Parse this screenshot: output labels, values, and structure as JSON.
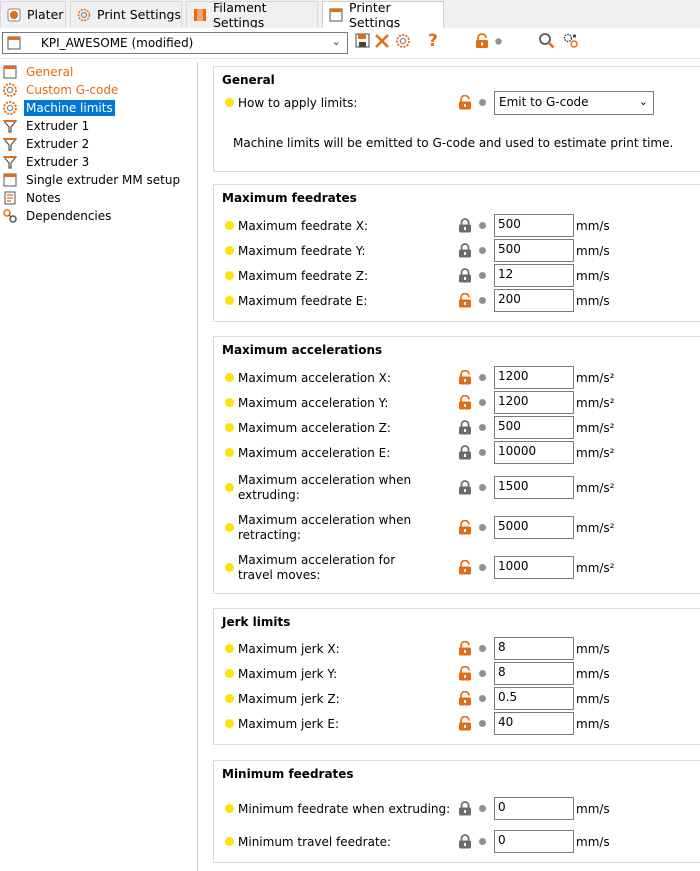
{
  "tabs": [
    {
      "label": "Plater",
      "icon": "plater-icon"
    },
    {
      "label": "Print Settings",
      "icon": "print-settings-icon"
    },
    {
      "label": "Filament Settings",
      "icon": "filament-icon"
    },
    {
      "label": "Printer Settings",
      "icon": "printer-icon",
      "active": true
    }
  ],
  "toolbar": {
    "preset_name": "KPI_AWESOME (modified)",
    "icons": [
      "save-icon",
      "delete-icon",
      "compare-icon",
      "help-icon",
      "lock-icon",
      "dot-icon",
      "search-icon",
      "filter-icon"
    ]
  },
  "sidebar": {
    "items": [
      {
        "label": "General",
        "icon": "printer-icon",
        "style": "orange"
      },
      {
        "label": "Custom G-code",
        "icon": "gear-icon",
        "style": "orange"
      },
      {
        "label": "Machine limits",
        "icon": "gear-icon",
        "style": "selected"
      },
      {
        "label": "Extruder 1",
        "icon": "extruder-icon",
        "style": ""
      },
      {
        "label": "Extruder 2",
        "icon": "extruder-icon",
        "style": ""
      },
      {
        "label": "Extruder 3",
        "icon": "extruder-icon",
        "style": ""
      },
      {
        "label": "Single extruder MM setup",
        "icon": "printer-icon",
        "style": ""
      },
      {
        "label": "Notes",
        "icon": "notes-icon",
        "style": ""
      },
      {
        "label": "Dependencies",
        "icon": "dependencies-icon",
        "style": ""
      }
    ]
  },
  "general": {
    "title": "General",
    "apply_label": "How to apply limits:",
    "apply_value": "Emit to G-code",
    "note": "Machine limits will be emitted to G-code and used to estimate print time."
  },
  "feedrates": {
    "title": "Maximum feedrates",
    "rows": [
      {
        "label": "Maximum feedrate X:",
        "value": "500",
        "unit": "mm/s",
        "lock": "locked"
      },
      {
        "label": "Maximum feedrate Y:",
        "value": "500",
        "unit": "mm/s",
        "lock": "locked"
      },
      {
        "label": "Maximum feedrate Z:",
        "value": "12",
        "unit": "mm/s",
        "lock": "locked"
      },
      {
        "label": "Maximum feedrate E:",
        "value": "200",
        "unit": "mm/s",
        "lock": "unlocked"
      }
    ]
  },
  "accelerations": {
    "title": "Maximum accelerations",
    "rows": [
      {
        "label": "Maximum acceleration X:",
        "value": "1200",
        "unit": "mm/s²",
        "lock": "unlocked"
      },
      {
        "label": "Maximum acceleration Y:",
        "value": "1200",
        "unit": "mm/s²",
        "lock": "unlocked"
      },
      {
        "label": "Maximum acceleration Z:",
        "value": "500",
        "unit": "mm/s²",
        "lock": "locked"
      },
      {
        "label": "Maximum acceleration E:",
        "value": "10000",
        "unit": "mm/s²",
        "lock": "locked"
      },
      {
        "label": "Maximum acceleration when extruding:",
        "value": "1500",
        "unit": "mm/s²",
        "lock": "locked"
      },
      {
        "label": "Maximum acceleration when retracting:",
        "value": "5000",
        "unit": "mm/s²",
        "lock": "unlocked"
      },
      {
        "label": "Maximum acceleration for travel moves:",
        "value": "1000",
        "unit": "mm/s²",
        "lock": "unlocked"
      }
    ]
  },
  "jerk": {
    "title": "Jerk limits",
    "rows": [
      {
        "label": "Maximum jerk X:",
        "value": "8",
        "unit": "mm/s",
        "lock": "unlocked"
      },
      {
        "label": "Maximum jerk Y:",
        "value": "8",
        "unit": "mm/s",
        "lock": "unlocked"
      },
      {
        "label": "Maximum jerk Z:",
        "value": "0.5",
        "unit": "mm/s",
        "lock": "unlocked"
      },
      {
        "label": "Maximum jerk E:",
        "value": "40",
        "unit": "mm/s",
        "lock": "unlocked"
      }
    ]
  },
  "min_feedrates": {
    "title": "Minimum feedrates",
    "rows": [
      {
        "label": "Minimum feedrate when extruding:",
        "value": "0",
        "unit": "mm/s",
        "lock": "locked"
      },
      {
        "label": "Minimum travel feedrate:",
        "value": "0",
        "unit": "mm/s",
        "lock": "locked"
      }
    ]
  },
  "colors": {
    "accent_orange": "#e56b15",
    "selection_blue": "#0078d7",
    "bullet_yellow": "#ffe200",
    "lock_gray": "#6b6b6b"
  }
}
